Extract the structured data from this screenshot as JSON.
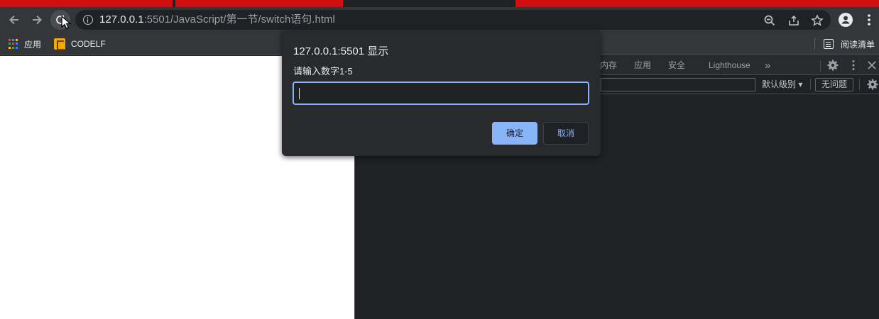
{
  "browser": {
    "address": {
      "host": "127.0.0.1",
      "port_path": ":5501/JavaScript/第一节/switch语句.html"
    },
    "bookmarks": {
      "apps_label": "应用",
      "codelf_label": "CODELF",
      "reading_list_label": "阅读清单"
    }
  },
  "devtools": {
    "tabs": [
      "内存",
      "应用",
      "安全",
      "Lighthouse"
    ],
    "more_tabs_glyph": "»",
    "console": {
      "level_label": "默认级别 ▾",
      "issues_label": "无问题"
    }
  },
  "dialog": {
    "title": "127.0.0.1:5501 显示",
    "message": "请输入数字1-5",
    "input_value": "",
    "ok_label": "确定",
    "cancel_label": "取消"
  },
  "colors": {
    "accent": "#8ab4f8",
    "tab_red": "#d10f10",
    "toolbar": "#35363a",
    "dialog_bg": "#292a2d"
  }
}
